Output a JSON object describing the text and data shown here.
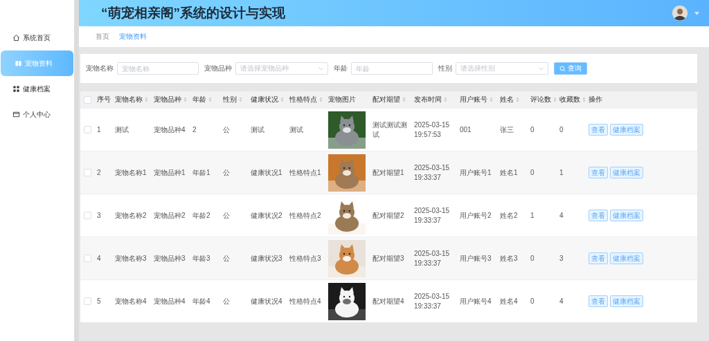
{
  "header": {
    "title": "“萌宠相亲阁”系统的设计与实现"
  },
  "sidebar": {
    "items": [
      {
        "label": "系统首页",
        "selected": false
      },
      {
        "label": "宠物资料",
        "selected": true
      },
      {
        "label": "健康档案",
        "selected": false
      },
      {
        "label": "个人中心",
        "selected": false
      }
    ]
  },
  "breadcrumb": [
    {
      "label": "首页",
      "selected": false
    },
    {
      "label": "宠物资料",
      "selected": true
    }
  ],
  "search": {
    "fields": [
      {
        "label": "宠物名称",
        "kind": "input",
        "placeholder": "宠物名称"
      },
      {
        "label": "宠物品种",
        "kind": "select",
        "placeholder": "请选择宠物品种"
      },
      {
        "label": "年龄",
        "kind": "input",
        "placeholder": "年龄"
      },
      {
        "label": "性别",
        "kind": "select",
        "placeholder": "请选择性别"
      }
    ],
    "button": "查询"
  },
  "table": {
    "select_all_checked": false,
    "columns": [
      {
        "label": "序号",
        "sortable": false
      },
      {
        "label": "宠物名称",
        "sortable": true
      },
      {
        "label": "宠物品种",
        "sortable": true
      },
      {
        "label": "年龄",
        "sortable": true
      },
      {
        "label": "性别",
        "sortable": true
      },
      {
        "label": "健康状况",
        "sortable": true
      },
      {
        "label": "性格特点",
        "sortable": true
      },
      {
        "label": "宠物图片",
        "sortable": false
      },
      {
        "label": "配对期望",
        "sortable": true
      },
      {
        "label": "发布时间",
        "sortable": true
      },
      {
        "label": "用户账号",
        "sortable": true
      },
      {
        "label": "姓名",
        "sortable": true
      },
      {
        "label": "评论数",
        "sortable": true
      },
      {
        "label": "收藏数",
        "sortable": true
      },
      {
        "label": "操作",
        "sortable": false
      }
    ],
    "rows": [
      {
        "checked": false,
        "cells": [
          "1",
          "测试",
          "宠物品种4",
          "2",
          "公",
          "测试",
          "测试"
        ],
        "cells_after": [
          "测试测试测试",
          "2025-03-15 19:57:53",
          "001",
          "张三",
          "0",
          "0"
        ],
        "actions": [
          "查看",
          "健康档案"
        ]
      },
      {
        "checked": false,
        "cells": [
          "2",
          "宠物名称1",
          "宠物品种1",
          "年龄1",
          "公",
          "健康状况1",
          "性格特点1"
        ],
        "cells_after": [
          "配对期望1",
          "2025-03-15 19:33:37",
          "用户账号1",
          "姓名1",
          "0",
          "1"
        ],
        "actions": [
          "查看",
          "健康档案"
        ]
      },
      {
        "checked": false,
        "cells": [
          "3",
          "宠物名称2",
          "宠物品种2",
          "年龄2",
          "公",
          "健康状况2",
          "性格特点2"
        ],
        "cells_after": [
          "配对期望2",
          "2025-03-15 19:33:37",
          "用户账号2",
          "姓名2",
          "1",
          "4"
        ],
        "actions": [
          "查看",
          "健康档案"
        ]
      },
      {
        "checked": false,
        "cells": [
          "4",
          "宠物名称3",
          "宠物品种3",
          "年龄3",
          "公",
          "健康状况3",
          "性格特点3"
        ],
        "cells_after": [
          "配对期望3",
          "2025-03-15 19:33:37",
          "用户账号3",
          "姓名3",
          "0",
          "3"
        ],
        "actions": [
          "查看",
          "健康档案"
        ]
      },
      {
        "checked": false,
        "cells": [
          "5",
          "宠物名称4",
          "宠物品种4",
          "年龄4",
          "公",
          "健康状况4",
          "性格特点4"
        ],
        "cells_after": [
          "配对期望4",
          "2025-03-15 19:33:37",
          "用户账号4",
          "姓名4",
          "0",
          "4"
        ],
        "actions": [
          "查看",
          "健康档案"
        ]
      }
    ]
  }
}
